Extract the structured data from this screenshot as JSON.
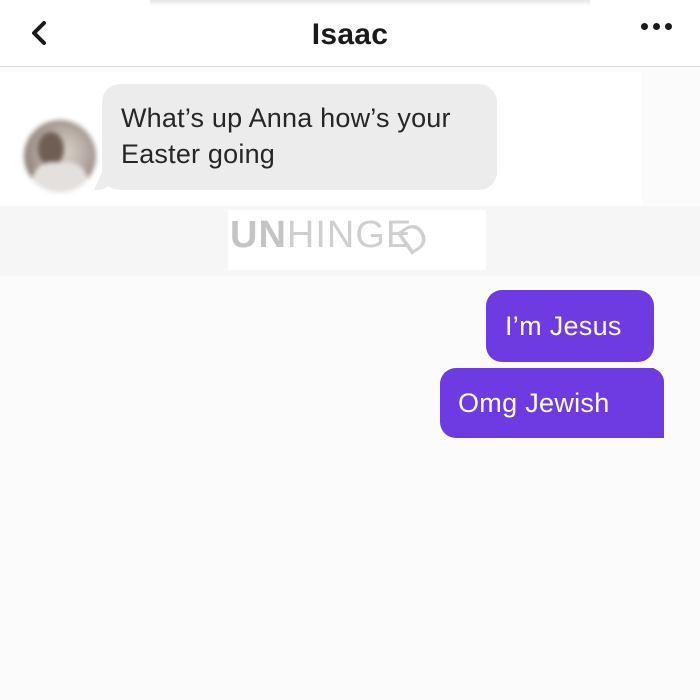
{
  "header": {
    "title": "Isaac",
    "back_icon": "chevron-left-icon",
    "more_icon": "more-horizontal-icon"
  },
  "conversation": {
    "incoming": [
      {
        "text": "What’s up Anna how’s your Easter going"
      }
    ],
    "outgoing": [
      {
        "text": "I’m Jesus"
      },
      {
        "text": "Omg Jewish"
      }
    ]
  },
  "watermark": {
    "bold": "UN",
    "light": "HINGE",
    "tilted": "D"
  },
  "colors": {
    "accent": "#6e3be3",
    "incoming_bubble": "#ececec",
    "background": "#fbfbfb",
    "text_dark": "#1a1a1a"
  }
}
